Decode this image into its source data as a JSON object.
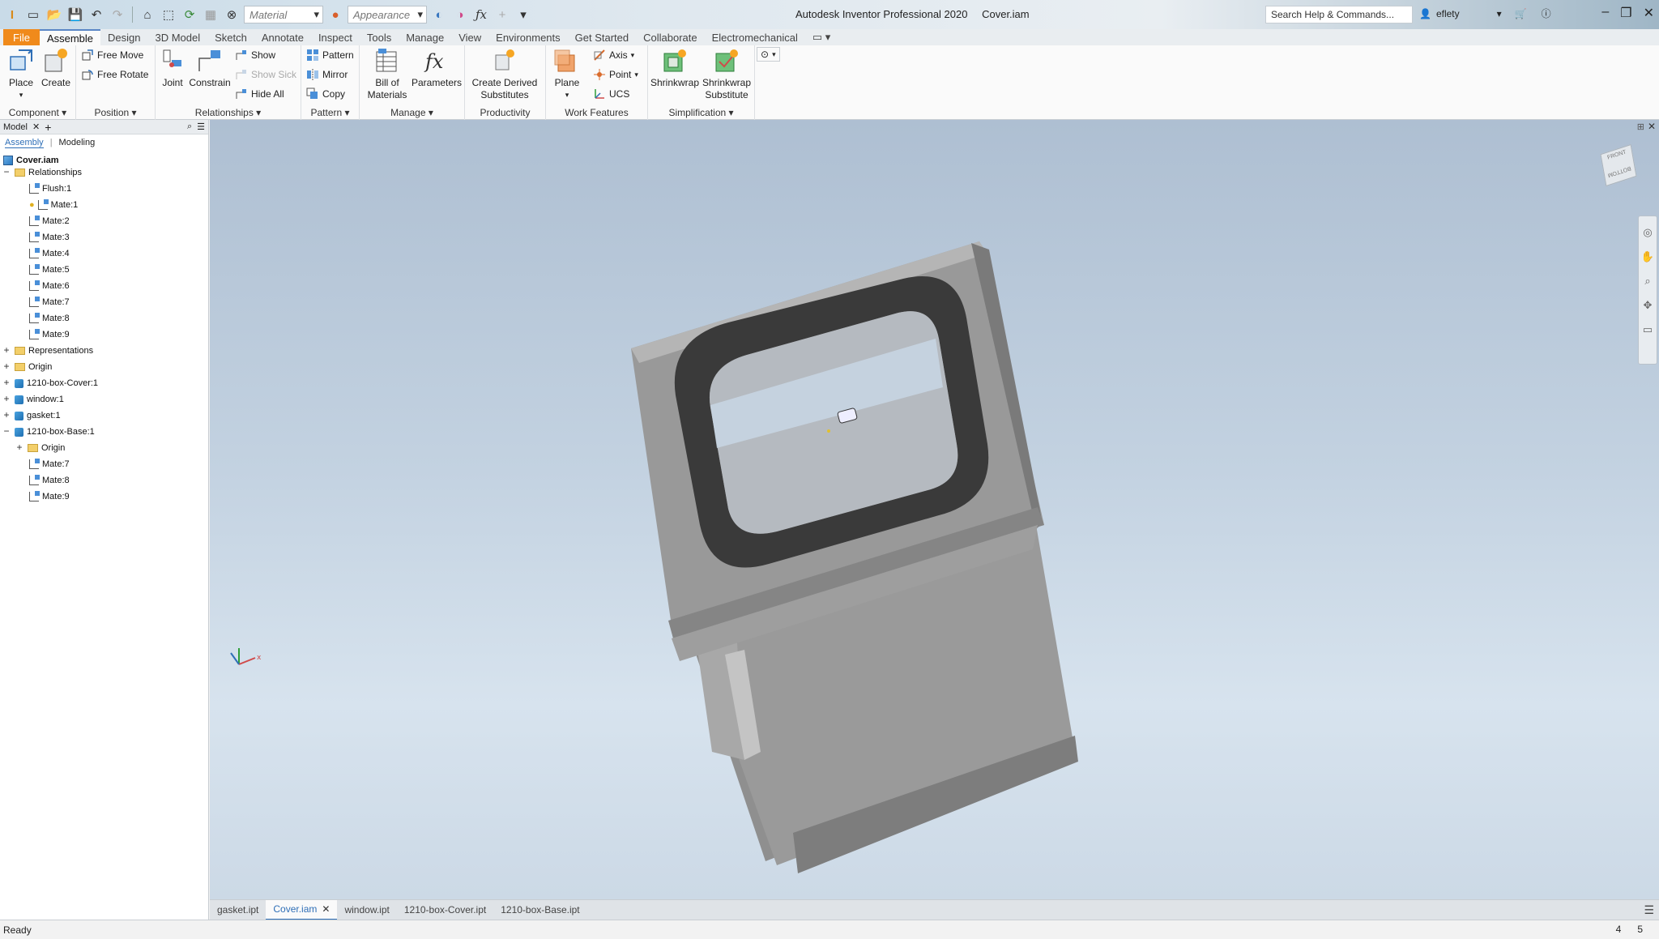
{
  "app": {
    "title": "Autodesk Inventor Professional 2020",
    "document": "Cover.iam"
  },
  "qat": {
    "material_placeholder": "Material",
    "appearance_placeholder": "Appearance"
  },
  "search": {
    "text": "Search Help & Commands..."
  },
  "user": {
    "name": "eflety"
  },
  "tabs": [
    "File",
    "Assemble",
    "Design",
    "3D Model",
    "Sketch",
    "Annotate",
    "Inspect",
    "Tools",
    "Manage",
    "View",
    "Environments",
    "Get Started",
    "Collaborate",
    "Electromechanical"
  ],
  "ribbon": {
    "component": {
      "label": "Component",
      "place": "Place",
      "create": "Create"
    },
    "position": {
      "label": "Position",
      "free_move": "Free Move",
      "free_rotate": "Free Rotate"
    },
    "relationships": {
      "label": "Relationships",
      "joint": "Joint",
      "constrain": "Constrain",
      "show": "Show",
      "show_sick": "Show Sick",
      "hide_all": "Hide All"
    },
    "pattern": {
      "label": "Pattern",
      "pattern": "Pattern",
      "mirror": "Mirror",
      "copy": "Copy"
    },
    "manage": {
      "label": "Manage",
      "bom_line1": "Bill of",
      "bom_line2": "Materials",
      "parameters": "Parameters"
    },
    "productivity": {
      "label": "Productivity",
      "cds_line1": "Create Derived",
      "cds_line2": "Substitutes"
    },
    "work_features": {
      "label": "Work Features",
      "plane": "Plane",
      "axis": "Axis",
      "point": "Point",
      "ucs": "UCS"
    },
    "simplification": {
      "label": "Simplification",
      "shrinkwrap": "Shrinkwrap",
      "sws_line1": "Shrinkwrap",
      "sws_line2": "Substitute"
    }
  },
  "browser": {
    "title": "Model",
    "subtabs": {
      "assembly": "Assembly",
      "modeling": "Modeling"
    },
    "nodes": [
      "Cover.iam",
      "Relationships",
      "Flush:1",
      "Mate:1",
      "Mate:2",
      "Mate:3",
      "Mate:4",
      "Mate:5",
      "Mate:6",
      "Mate:7",
      "Mate:8",
      "Mate:9",
      "Representations",
      "Origin",
      "1210-box-Cover:1",
      "window:1",
      "gasket:1",
      "1210-box-Base:1",
      "Origin",
      "Mate:7",
      "Mate:8",
      "Mate:9"
    ]
  },
  "viewcube": {
    "front": "FRONT",
    "bottom": "BOTTOM"
  },
  "doc_tabs": [
    "gasket.ipt",
    "Cover.iam",
    "window.ipt",
    "1210-box-Cover.ipt",
    "1210-box-Base.ipt"
  ],
  "status": {
    "text": "Ready",
    "n1": "4",
    "n2": "5"
  }
}
